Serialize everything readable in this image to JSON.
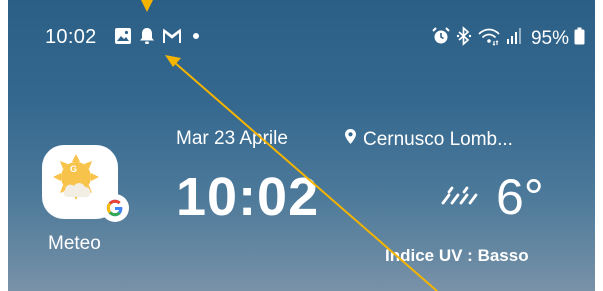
{
  "status_bar": {
    "time": "10:02",
    "battery": "95%",
    "icons_left": [
      "gallery-icon",
      "bell-icon",
      "gmail-icon",
      "notification-dot-icon"
    ],
    "icons_right": [
      "alarm-icon",
      "bluetooth-icon",
      "wifi-icon",
      "cell-signal-icon",
      "battery-icon"
    ]
  },
  "app": {
    "label": "Meteo",
    "icon": "google-weather-icon"
  },
  "widget": {
    "date": "Mar 23 Aprile",
    "time": "10:02",
    "location": "Cernusco Lomb...",
    "location_icon": "location-pin-icon",
    "temperature": "6°",
    "weather_icon": "rain-icon",
    "uv": "Indice UV : Basso"
  },
  "colors": {
    "annotation": "#f5b400",
    "sun": "#f7c34a",
    "background_top": "#2b5f86",
    "background_bottom": "#7a92a8"
  }
}
